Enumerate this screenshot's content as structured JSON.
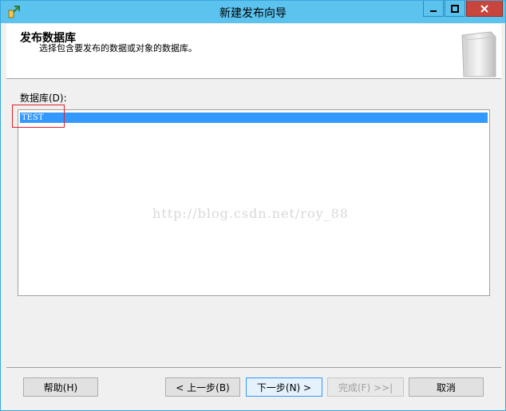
{
  "window": {
    "title": "新建发布向导",
    "app_icon": "wizard-icon"
  },
  "header": {
    "title": "发布数据库",
    "subtitle": "选择包含要发布的数据或对象的数据库。",
    "image": "database-cylinder-icon"
  },
  "database": {
    "label": "数据库(D):",
    "items": [
      {
        "name": "TEST",
        "selected": true
      }
    ]
  },
  "watermark": "http://blog.csdn.net/roy_88",
  "buttons": {
    "help": "帮助(H)",
    "back": "< 上一步(B)",
    "next": "下一步(N) >",
    "finish": "完成(F) >>|",
    "cancel": "取消"
  },
  "colors": {
    "titlebar": "#5bc3ee",
    "selection": "#3399ff",
    "close": "#c7453c",
    "highlight": "#e0202a"
  }
}
